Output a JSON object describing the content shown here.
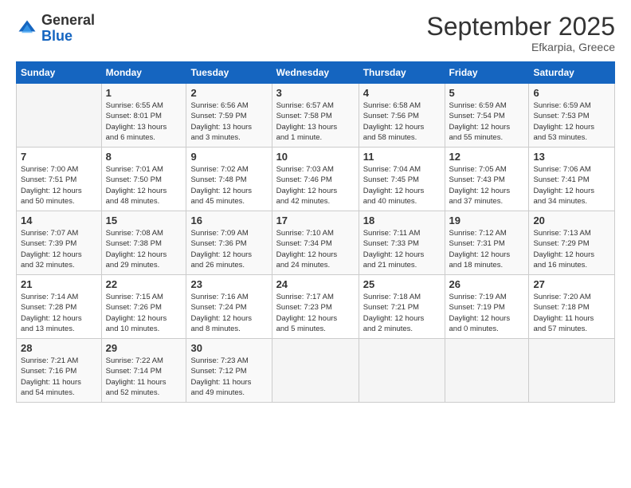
{
  "logo": {
    "general": "General",
    "blue": "Blue"
  },
  "title": "September 2025",
  "location": "Efkarpia, Greece",
  "days_header": [
    "Sunday",
    "Monday",
    "Tuesday",
    "Wednesday",
    "Thursday",
    "Friday",
    "Saturday"
  ],
  "weeks": [
    [
      {
        "day": "",
        "info": ""
      },
      {
        "day": "1",
        "info": "Sunrise: 6:55 AM\nSunset: 8:01 PM\nDaylight: 13 hours\nand 6 minutes."
      },
      {
        "day": "2",
        "info": "Sunrise: 6:56 AM\nSunset: 7:59 PM\nDaylight: 13 hours\nand 3 minutes."
      },
      {
        "day": "3",
        "info": "Sunrise: 6:57 AM\nSunset: 7:58 PM\nDaylight: 13 hours\nand 1 minute."
      },
      {
        "day": "4",
        "info": "Sunrise: 6:58 AM\nSunset: 7:56 PM\nDaylight: 12 hours\nand 58 minutes."
      },
      {
        "day": "5",
        "info": "Sunrise: 6:59 AM\nSunset: 7:54 PM\nDaylight: 12 hours\nand 55 minutes."
      },
      {
        "day": "6",
        "info": "Sunrise: 6:59 AM\nSunset: 7:53 PM\nDaylight: 12 hours\nand 53 minutes."
      }
    ],
    [
      {
        "day": "7",
        "info": "Sunrise: 7:00 AM\nSunset: 7:51 PM\nDaylight: 12 hours\nand 50 minutes."
      },
      {
        "day": "8",
        "info": "Sunrise: 7:01 AM\nSunset: 7:50 PM\nDaylight: 12 hours\nand 48 minutes."
      },
      {
        "day": "9",
        "info": "Sunrise: 7:02 AM\nSunset: 7:48 PM\nDaylight: 12 hours\nand 45 minutes."
      },
      {
        "day": "10",
        "info": "Sunrise: 7:03 AM\nSunset: 7:46 PM\nDaylight: 12 hours\nand 42 minutes."
      },
      {
        "day": "11",
        "info": "Sunrise: 7:04 AM\nSunset: 7:45 PM\nDaylight: 12 hours\nand 40 minutes."
      },
      {
        "day": "12",
        "info": "Sunrise: 7:05 AM\nSunset: 7:43 PM\nDaylight: 12 hours\nand 37 minutes."
      },
      {
        "day": "13",
        "info": "Sunrise: 7:06 AM\nSunset: 7:41 PM\nDaylight: 12 hours\nand 34 minutes."
      }
    ],
    [
      {
        "day": "14",
        "info": "Sunrise: 7:07 AM\nSunset: 7:39 PM\nDaylight: 12 hours\nand 32 minutes."
      },
      {
        "day": "15",
        "info": "Sunrise: 7:08 AM\nSunset: 7:38 PM\nDaylight: 12 hours\nand 29 minutes."
      },
      {
        "day": "16",
        "info": "Sunrise: 7:09 AM\nSunset: 7:36 PM\nDaylight: 12 hours\nand 26 minutes."
      },
      {
        "day": "17",
        "info": "Sunrise: 7:10 AM\nSunset: 7:34 PM\nDaylight: 12 hours\nand 24 minutes."
      },
      {
        "day": "18",
        "info": "Sunrise: 7:11 AM\nSunset: 7:33 PM\nDaylight: 12 hours\nand 21 minutes."
      },
      {
        "day": "19",
        "info": "Sunrise: 7:12 AM\nSunset: 7:31 PM\nDaylight: 12 hours\nand 18 minutes."
      },
      {
        "day": "20",
        "info": "Sunrise: 7:13 AM\nSunset: 7:29 PM\nDaylight: 12 hours\nand 16 minutes."
      }
    ],
    [
      {
        "day": "21",
        "info": "Sunrise: 7:14 AM\nSunset: 7:28 PM\nDaylight: 12 hours\nand 13 minutes."
      },
      {
        "day": "22",
        "info": "Sunrise: 7:15 AM\nSunset: 7:26 PM\nDaylight: 12 hours\nand 10 minutes."
      },
      {
        "day": "23",
        "info": "Sunrise: 7:16 AM\nSunset: 7:24 PM\nDaylight: 12 hours\nand 8 minutes."
      },
      {
        "day": "24",
        "info": "Sunrise: 7:17 AM\nSunset: 7:23 PM\nDaylight: 12 hours\nand 5 minutes."
      },
      {
        "day": "25",
        "info": "Sunrise: 7:18 AM\nSunset: 7:21 PM\nDaylight: 12 hours\nand 2 minutes."
      },
      {
        "day": "26",
        "info": "Sunrise: 7:19 AM\nSunset: 7:19 PM\nDaylight: 12 hours\nand 0 minutes."
      },
      {
        "day": "27",
        "info": "Sunrise: 7:20 AM\nSunset: 7:18 PM\nDaylight: 11 hours\nand 57 minutes."
      }
    ],
    [
      {
        "day": "28",
        "info": "Sunrise: 7:21 AM\nSunset: 7:16 PM\nDaylight: 11 hours\nand 54 minutes."
      },
      {
        "day": "29",
        "info": "Sunrise: 7:22 AM\nSunset: 7:14 PM\nDaylight: 11 hours\nand 52 minutes."
      },
      {
        "day": "30",
        "info": "Sunrise: 7:23 AM\nSunset: 7:12 PM\nDaylight: 11 hours\nand 49 minutes."
      },
      {
        "day": "",
        "info": ""
      },
      {
        "day": "",
        "info": ""
      },
      {
        "day": "",
        "info": ""
      },
      {
        "day": "",
        "info": ""
      }
    ]
  ]
}
